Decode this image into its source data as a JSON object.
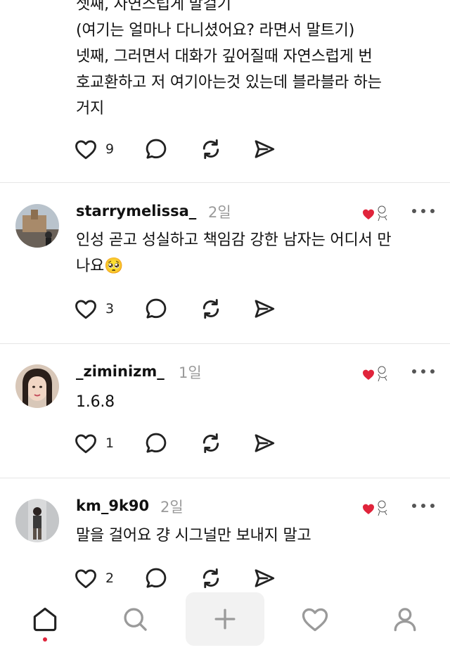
{
  "posts": [
    {
      "body_lines": [
        "셋째, 자연스럽게 말걸기",
        "(여기는 얼마나 다니셨어요? 라면서 말트기)",
        "넷째, 그러면서 대화가 깊어질때 자연스럽게 번",
        "호교환하고 저 여기아는것 있는데 블라블라 하는",
        "거지"
      ],
      "like_count": "9"
    },
    {
      "username": "starrymelissa_",
      "time": "2일",
      "body_lines": [
        "인성 곧고 성실하고 책임감 강한 남자는 어디서 만",
        "나요🥺"
      ],
      "like_count": "3"
    },
    {
      "username": "_ziminizm_",
      "time": "1일",
      "body_lines": [
        "1.6.8"
      ],
      "like_count": "1"
    },
    {
      "username": "km_9k90",
      "time": "2일",
      "body_lines": [
        "말을 걸어요 걍 시그널만 보내지 말고"
      ],
      "like_count": "2"
    }
  ],
  "nav": [
    "home",
    "search",
    "create",
    "activity",
    "profile"
  ],
  "colors": {
    "accent_red": "#e0243b",
    "muted": "#9a9a9a",
    "icon": "#222222",
    "divider": "#e6e6e6"
  }
}
